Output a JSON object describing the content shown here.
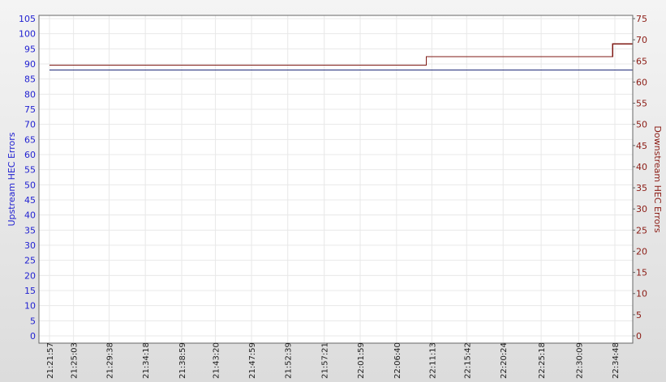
{
  "chart_data": {
    "type": "line",
    "x": [
      "21:21:57",
      "21:25:03",
      "21:29:38",
      "21:34:18",
      "21:38:59",
      "21:43:20",
      "21:47:59",
      "21:52:39",
      "21:57:21",
      "22:01:59",
      "22:06:40",
      "22:11:13",
      "22:15:42",
      "22:20:24",
      "22:25:18",
      "22:30:09",
      "22:34:48"
    ],
    "xlim": [
      "21:21:57",
      "22:37:06"
    ],
    "left_axis": {
      "label": "Upstream HEC Errors",
      "ticks": [
        0,
        5,
        10,
        15,
        20,
        25,
        30,
        35,
        40,
        45,
        50,
        55,
        60,
        65,
        70,
        75,
        80,
        85,
        90,
        95,
        100,
        105
      ],
      "ylim": [
        0,
        105
      ]
    },
    "right_axis": {
      "label": "Downstream HEC Errors",
      "ticks": [
        0,
        5,
        10,
        15,
        20,
        25,
        30,
        35,
        40,
        45,
        50,
        55,
        60,
        65,
        70,
        75
      ],
      "ylim": [
        0,
        75
      ]
    },
    "series": [
      {
        "axis": "left",
        "color": "#1f2a78",
        "points": [
          [
            "21:21:57",
            88
          ],
          [
            "22:37:06",
            88
          ]
        ]
      },
      {
        "axis": "right",
        "color": "#7f1a14",
        "points": [
          [
            "21:21:57",
            64
          ],
          [
            "22:10:30",
            64
          ],
          [
            "22:10:30",
            66
          ],
          [
            "22:34:30",
            66
          ],
          [
            "22:34:30",
            69
          ],
          [
            "22:37:06",
            69
          ]
        ]
      }
    ],
    "grid": true,
    "colors": {
      "grid": "#e8e8e8",
      "left_axis": "#1f1fd1",
      "right_axis": "#8b1b14",
      "plot_border": "#666666"
    }
  }
}
